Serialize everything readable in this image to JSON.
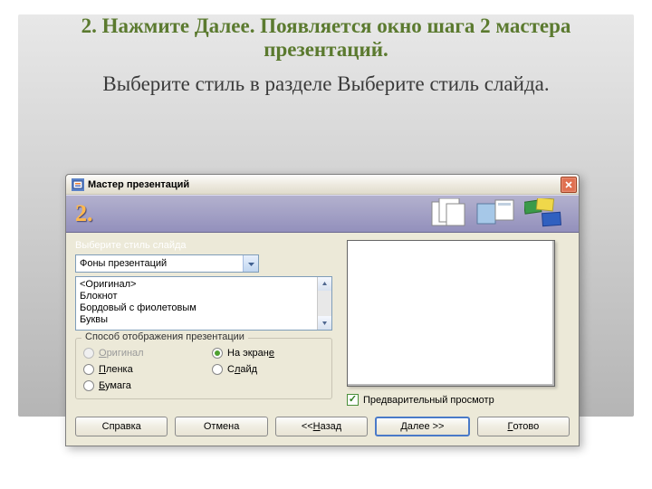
{
  "slide": {
    "title": "2. Нажмите Далее. Появляется окно шага 2 мастера презентаций.",
    "subtitle": "Выберите стиль в разделе Выберите стиль слайда."
  },
  "dialog": {
    "title": "Мастер презентаций",
    "step_number": "2.",
    "style_label": "Выберите стиль слайда",
    "combo_value": "Фоны презентаций",
    "list_items": [
      "<Оригинал>",
      "Блокнот",
      "Бордовый с фиолетовым",
      "Буквы"
    ],
    "display_group": "Способ отображения презентации",
    "radios": {
      "original": "Оригинал",
      "screen": "На экране",
      "film": "Пленка",
      "slide": "Слайд",
      "paper": "Бумага"
    },
    "preview_label": "Предварительный просмотр",
    "buttons": {
      "help": "Справка",
      "cancel": "Отмена",
      "back": "<< Назад",
      "next": "Далее >>",
      "finish": "Готово"
    }
  }
}
